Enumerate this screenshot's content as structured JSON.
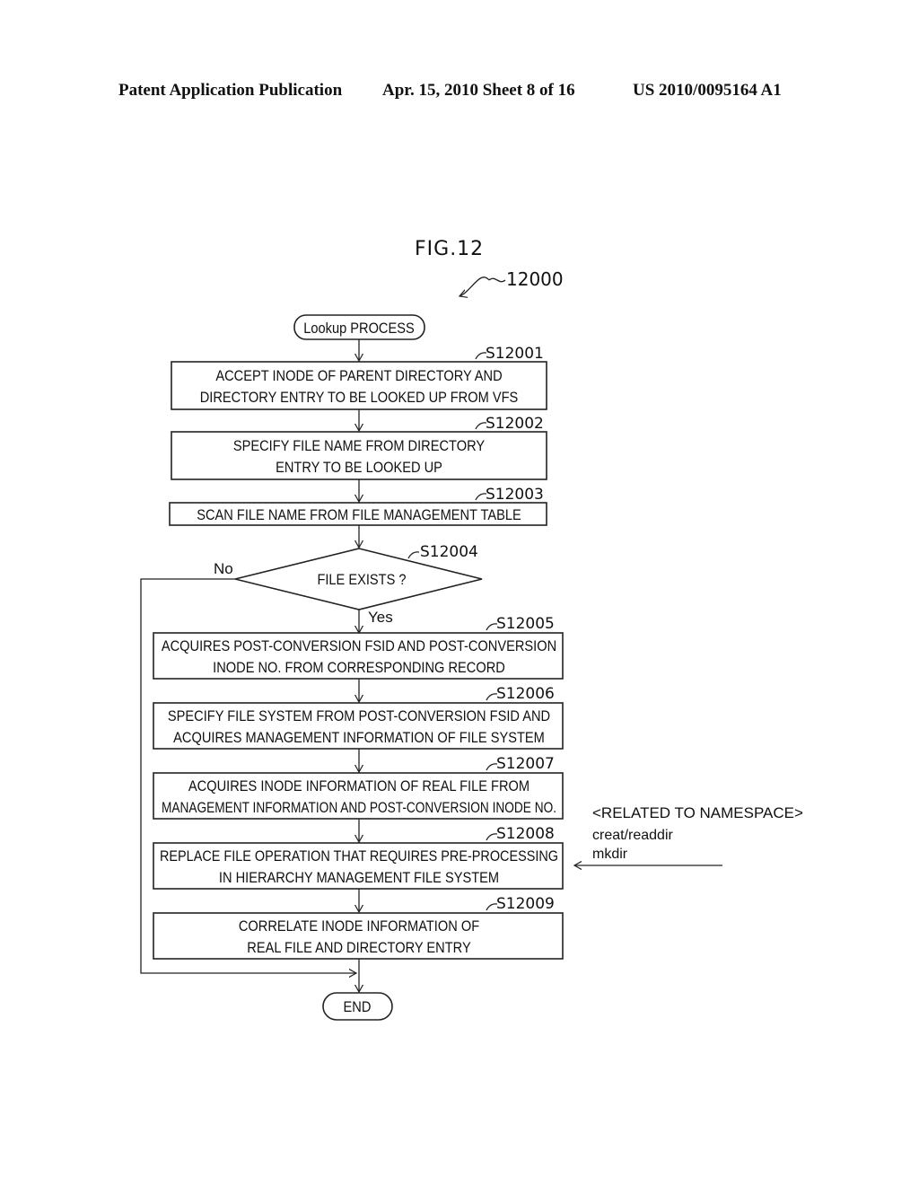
{
  "header": {
    "left": "Patent Application Publication",
    "middle": "Apr. 15, 2010  Sheet 8 of 16",
    "right": "US 2010/0095164 A1"
  },
  "figure": {
    "title": "FIG.12",
    "ref": "12000"
  },
  "flow": {
    "start": "Lookup PROCESS",
    "end": "END",
    "steps": [
      {
        "id": "S12001",
        "lines": [
          "ACCEPT INODE OF PARENT DIRECTORY AND",
          "DIRECTORY ENTRY TO BE LOOKED UP FROM VFS"
        ]
      },
      {
        "id": "S12002",
        "lines": [
          "SPECIFY FILE NAME FROM DIRECTORY",
          "ENTRY TO BE LOOKED UP"
        ]
      },
      {
        "id": "S12003",
        "lines": [
          "SCAN FILE NAME FROM FILE MANAGEMENT TABLE"
        ]
      },
      {
        "id": "S12004",
        "lines": [
          "FILE EXISTS ?"
        ],
        "yes": "Yes",
        "no": "No"
      },
      {
        "id": "S12005",
        "lines": [
          "ACQUIRES POST-CONVERSION FSID AND POST-CONVERSION",
          "INODE NO. FROM CORRESPONDING RECORD"
        ]
      },
      {
        "id": "S12006",
        "lines": [
          "SPECIFY FILE SYSTEM FROM POST-CONVERSION FSID AND",
          "ACQUIRES MANAGEMENT INFORMATION OF FILE SYSTEM"
        ]
      },
      {
        "id": "S12007",
        "lines": [
          "ACQUIRES INODE INFORMATION OF REAL FILE FROM",
          "MANAGEMENT INFORMATION AND POST-CONVERSION INODE NO."
        ]
      },
      {
        "id": "S12008",
        "lines": [
          "REPLACE FILE OPERATION THAT REQUIRES PRE-PROCESSING",
          "IN HIERARCHY MANAGEMENT FILE SYSTEM"
        ]
      },
      {
        "id": "S12009",
        "lines": [
          "CORRELATE INODE INFORMATION OF",
          "REAL FILE AND DIRECTORY ENTRY"
        ]
      }
    ]
  },
  "annotation": {
    "title": "<RELATED TO NAMESPACE>",
    "lines": [
      "creat/readdir",
      "mkdir"
    ]
  }
}
